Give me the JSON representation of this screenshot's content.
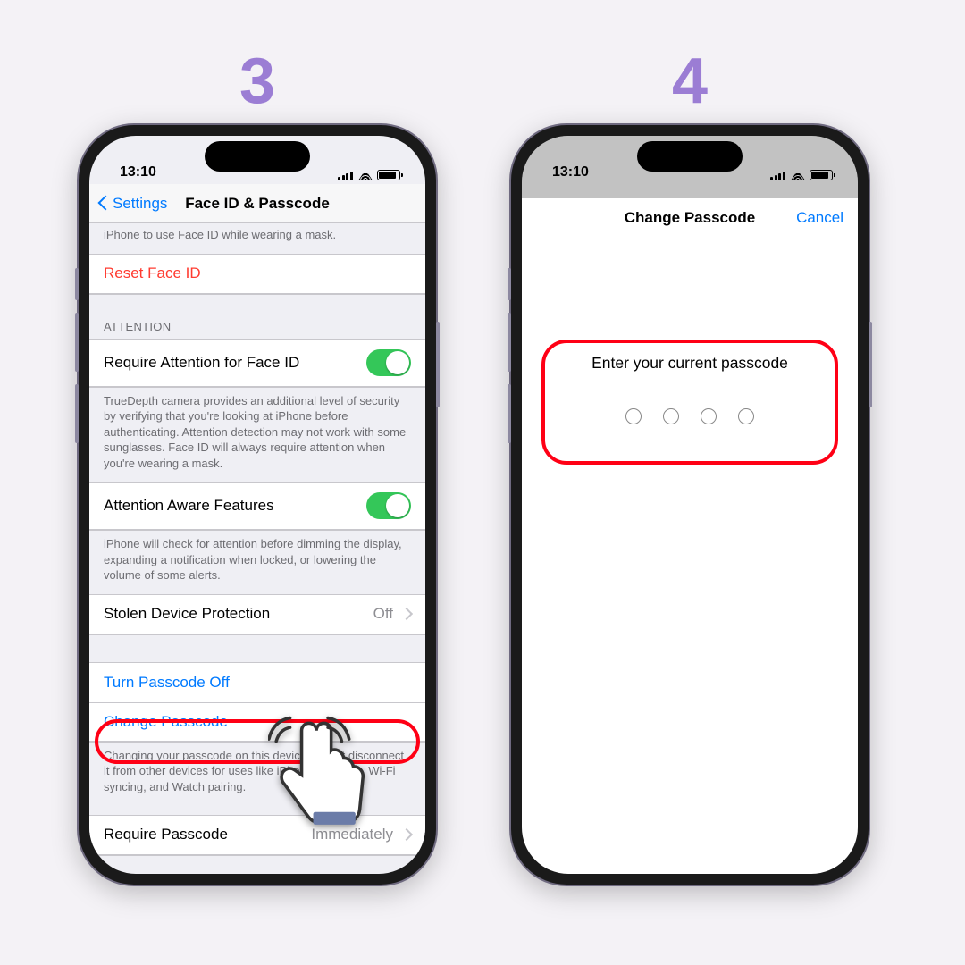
{
  "step_left": "3",
  "step_right": "4",
  "status_time": "13:10",
  "screen1": {
    "back_label": "Settings",
    "title": "Face ID & Passcode",
    "top_hint": "iPhone to use Face ID while wearing a mask.",
    "reset_faceid": "Reset Face ID",
    "attention_header": "ATTENTION",
    "require_attention": "Require Attention for Face ID",
    "require_attention_hint": "TrueDepth camera provides an additional level of security by verifying that you're looking at iPhone before authenticating. Attention detection may not work with some sunglasses. Face ID will always require attention when you're wearing a mask.",
    "aware_features": "Attention Aware Features",
    "aware_hint": "iPhone will check for attention before dimming the display, expanding a notification when locked, or lowering the volume of some alerts.",
    "stolen": "Stolen Device Protection",
    "stolen_value": "Off",
    "turn_off": "Turn Passcode Off",
    "change": "Change Passcode",
    "change_hint": "Changing your passcode on this device will not disconnect it from other devices for uses like iPhone Mirroring, Wi-Fi syncing, and Watch pairing.",
    "require_passcode": "Require Passcode",
    "require_passcode_value": "Immediately"
  },
  "screen2": {
    "title": "Change Passcode",
    "cancel": "Cancel",
    "prompt": "Enter your current passcode"
  }
}
